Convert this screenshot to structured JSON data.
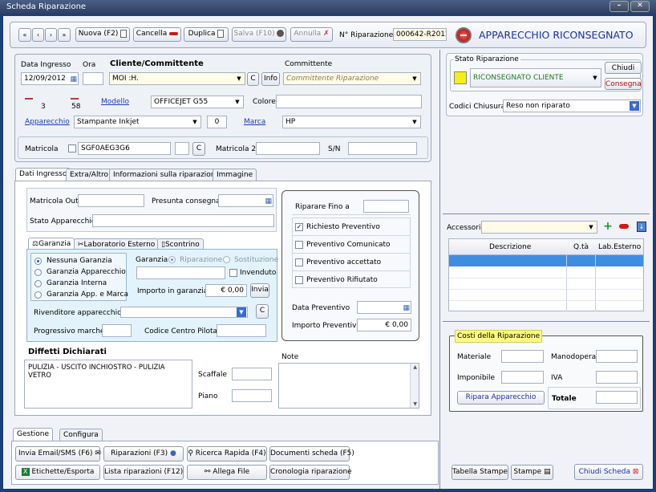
{
  "window": {
    "title": "Scheda Riparazione",
    "min_label": "–",
    "close_label": "✕"
  },
  "toolbar": {
    "nuova": "Nuova (F2)",
    "cancella": "Cancella",
    "duplica": "Duplica",
    "salva": "Salva (F10)",
    "annulla": "Annulla",
    "num_label": "N° Riparazione",
    "num_value": "000642-R2012",
    "status_banner": "APPARECCHIO RICONSEGNATO"
  },
  "ingresso": {
    "data_label": "Data Ingresso",
    "data_value": "12/09/2012",
    "ora_label": "Ora",
    "ora_value": "",
    "cliente_label": "Cliente/Committente",
    "cliente_value": "MOI              :H.",
    "c_btn": "C",
    "info_btn": "Info",
    "committente_label": "Committente",
    "committente_placeholder": "Committente Riparazione",
    "counter_a": "3",
    "counter_b": "58",
    "modello_label": "Modello",
    "modello_value": "OFFICEJET G55",
    "colore_label": "Colore",
    "colore_value": "",
    "apparecchio_label": "Apparecchio",
    "apparecchio_value": "Stampante Inkjet",
    "apparecchio_qty": "0",
    "marca_label": "Marca",
    "marca_value": "HP",
    "matricola_label": "Matricola",
    "matricola_value": "SGF0AEG3G6",
    "matricola2_label": "Matricola 2",
    "matricola2_value": "",
    "sn_label": "S/N",
    "sn_value": ""
  },
  "stato": {
    "title": "Stato Riparazione",
    "value": "RICONSEGNATO CLIENTE",
    "chiudi": "Chiudi",
    "consegna": "Consegna",
    "codici_label": "Codici Chiusura",
    "codici_value": "Reso non riparato"
  },
  "tabs": [
    "Dati Ingresso",
    "Extra/Altro",
    "Informazioni sulla riparazione",
    "Immagine"
  ],
  "dati": {
    "matricola_out_label": "Matricola Out",
    "presunta_label": "Presunta consegna",
    "stato_app_label": "Stato Apparecchio",
    "riparare_label": "Riparare Fino a",
    "prev_richiesto": "Richiesto Preventivo",
    "prev_comunicato": "Preventivo Comunicato",
    "prev_accettato": "Preventivo accettato",
    "prev_rifiutato": "Preventivo Rifiutato",
    "data_prev_label": "Data Preventivo",
    "importo_prev_label": "Importo Preventivo",
    "importo_prev_value": "€ 0,00"
  },
  "garanzia": {
    "tabs": [
      "Garanzia",
      "Laboratorio Esterno",
      "Scontrino"
    ],
    "options": [
      "Nessuna Garanzia",
      "Garanzia Apparecchio",
      "Garanzia Interna",
      "Garanzia App. e Marca"
    ],
    "garanzia_label": "Garanzia",
    "riparazione": "Riparazione",
    "sostituzione": "Sostituzione",
    "invenduto": "Invenduto",
    "importo_label": "Importo in garanzia",
    "importo_value": "€ 0,00",
    "invia": "Invia",
    "rivenditore_label": "Rivenditore apparecchio",
    "c_btn": "C",
    "progressivo_label": "Progressivo marche",
    "codice_label": "Codice Centro Pilota"
  },
  "difetti": {
    "title": "Diffetti Dichiarati",
    "text": "PULIZIA - USCITO INCHIOSTRO - PULIZIA VETRO",
    "scaffale": "Scaffale",
    "piano": "Piano",
    "note_label": "Note"
  },
  "accessori": {
    "label": "Accessori",
    "columns": [
      "Descrizione",
      "Q.tà",
      "Lab.Esterno"
    ]
  },
  "costi": {
    "title": "Costi della Riparazione",
    "materiale": "Materiale",
    "manodopera": "Manodopera",
    "imponibile": "Imponibile",
    "iva": "IVA",
    "ripara_btn": "Ripara Apparecchio",
    "totale": "Totale"
  },
  "bottom": {
    "tabs": [
      "Gestione",
      "Configura"
    ],
    "invia_email": "Invia Email/SMS (F6)",
    "riparazioni": "Riparazioni (F3)",
    "ricerca": "Ricerca Rapida (F4)",
    "documenti": "Documenti scheda (F5)",
    "etichette": "Etichette/Esporta",
    "lista": "Lista riparazioni (F12)",
    "allega": "Allega File",
    "cronologia": "Cronologia riparazione",
    "tabella_stampe": "Tabella Stampe",
    "stampe": "Stampe",
    "chiudi_scheda": "Chiudi Scheda"
  }
}
